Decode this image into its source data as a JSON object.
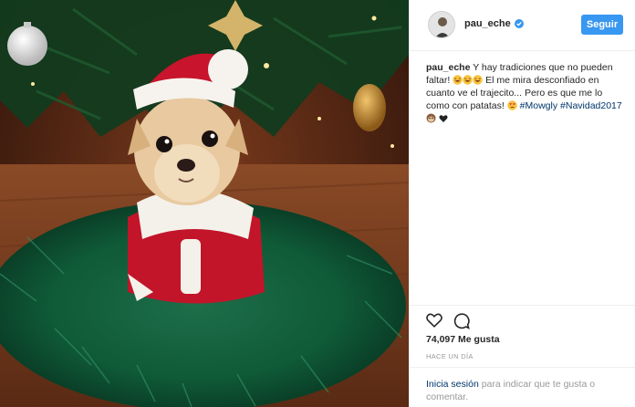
{
  "post": {
    "username": "pau_eche",
    "follow_label": "Seguir",
    "caption": {
      "user": "pau_eche",
      "text_1": "Y hay tradiciones que no pueden faltar!",
      "text_2": "El me mira desconfiado en cuanto ve el trajecito... Pero es que me lo como con patatas!",
      "hashtag_1": "#Mowgly",
      "hashtag_2": "#Navidad2017"
    },
    "likes": "74,097 Me gusta",
    "timestamp": "HACE UN DÍA",
    "login_link": "Inicia sesión",
    "login_text": "para indicar que te gusta o comentar."
  },
  "colors": {
    "accent": "#3897f0",
    "link": "#003569",
    "muted": "#999999"
  },
  "icons": [
    "verified-badge-icon",
    "heart-icon",
    "comment-icon",
    "laughing-emoji-icon",
    "heart-eyes-emoji-icon",
    "monkey-emoji-icon",
    "black-heart-icon"
  ]
}
